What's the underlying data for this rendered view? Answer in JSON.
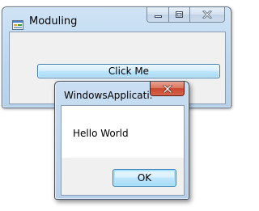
{
  "main_window": {
    "title": "Moduling",
    "icon": "form-app-icon",
    "caption_buttons": [
      "minimize-icon",
      "maximize-icon",
      "close-icon"
    ],
    "click_button_label": "Click Me"
  },
  "message_box": {
    "title": "WindowsApplicati...",
    "close_icon": "close-icon",
    "message": "Hello World",
    "ok_label": "OK"
  },
  "colors": {
    "frame": "#bcd6ee",
    "client": "#f0f0f0",
    "button_border": "#3c7fb1",
    "close_button": "#c8472d"
  }
}
